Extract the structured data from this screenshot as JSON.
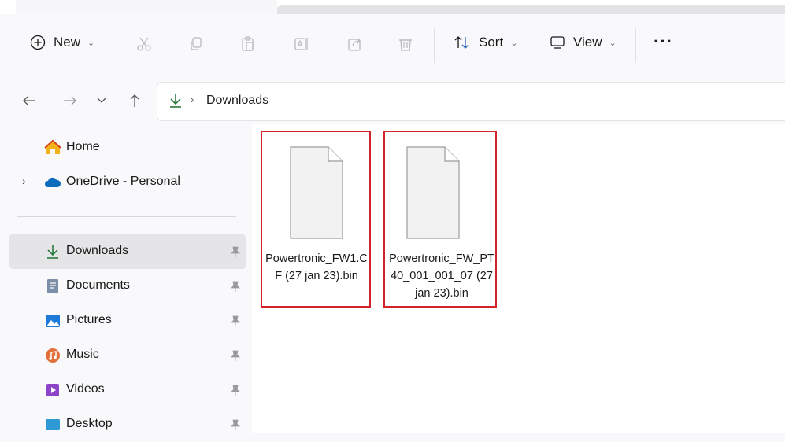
{
  "toolbar": {
    "new_label": "New",
    "sort_label": "Sort",
    "view_label": "View",
    "more_label": "···"
  },
  "address": {
    "crumbs": [
      "Downloads"
    ]
  },
  "sidebar": {
    "items": [
      {
        "label": "Home",
        "icon": "home-icon"
      },
      {
        "label": "OneDrive - Personal",
        "icon": "onedrive-cloud-icon"
      },
      {
        "label": "Downloads",
        "icon": "download-arrow-icon",
        "pinned": true,
        "selected": true
      },
      {
        "label": "Documents",
        "icon": "documents-icon",
        "pinned": true
      },
      {
        "label": "Pictures",
        "icon": "pictures-icon",
        "pinned": true
      },
      {
        "label": "Music",
        "icon": "music-icon",
        "pinned": true
      },
      {
        "label": "Videos",
        "icon": "videos-icon",
        "pinned": true
      },
      {
        "label": "Desktop",
        "icon": "desktop-icon",
        "pinned": true
      }
    ]
  },
  "files": [
    {
      "name": "Powertronic_FW1.CF (27 jan 23).bin",
      "icon": "generic-file-icon",
      "highlight": "#d2232a"
    },
    {
      "name": "Powertronic_FW_PT40_001_001_07 (27 jan 23).bin",
      "icon": "generic-file-icon",
      "highlight": "#d2232a"
    }
  ],
  "colors": {
    "accent": "#2a7a3b",
    "highlight_box": "#d2232a",
    "selected_bg": "#e5e5e8"
  }
}
